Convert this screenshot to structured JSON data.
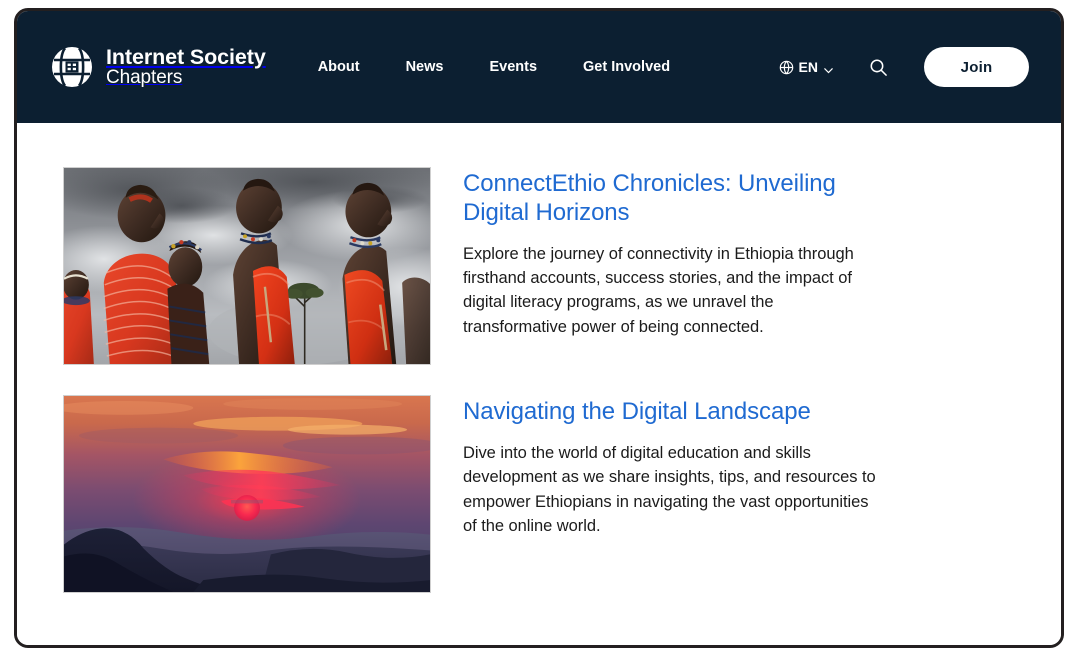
{
  "header": {
    "brand": {
      "icon": "globe-logo-icon",
      "line1": "Internet Society",
      "line2": "Chapters"
    },
    "nav": [
      {
        "label": "About"
      },
      {
        "label": "News"
      },
      {
        "label": "Events"
      },
      {
        "label": "Get Involved"
      }
    ],
    "language": {
      "icon": "globe-icon",
      "code": "EN",
      "chevron": "chevron-down-icon"
    },
    "search_icon": "search-icon",
    "join_label": "Join",
    "background_color": "#0c1f31",
    "text_color": "#ffffff"
  },
  "articles": [
    {
      "image_alt": "maasai-warriors-photo",
      "title": "ConnectEthio Chronicles: Unveiling Digital Horizons",
      "excerpt": "Explore the journey of connectivity in Ethiopia through firsthand accounts, success stories, and the impact of digital literacy programs, as we unravel the transformative power of being connected."
    },
    {
      "image_alt": "sunset-over-mountains-photo",
      "title": "Navigating the Digital Landscape",
      "excerpt": "Dive into the world of digital education and skills development as we share insights, tips, and resources to empower Ethiopians in navigating the vast opportunities of the online world."
    }
  ],
  "theme": {
    "link_blue": "#1f6ad1",
    "body_text": "#1b1b1b",
    "page_background": "#ffffff",
    "frame_border": "#231f20"
  }
}
